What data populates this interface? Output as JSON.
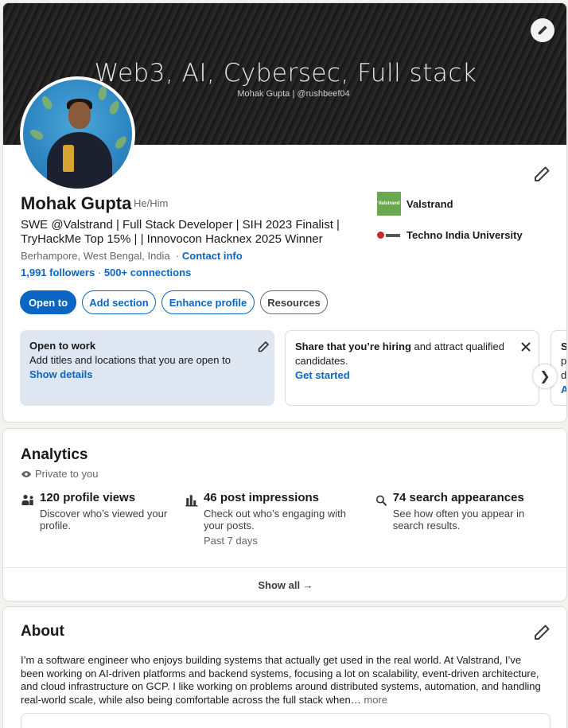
{
  "banner": {
    "title": "Web3, AI, Cybersec, Full stack",
    "subtitle": "Mohak Gupta | @rushbeef04"
  },
  "profile": {
    "name": "Mohak Gupta",
    "pronouns": "He/Him",
    "headline": "SWE @Valstrand | Full Stack Developer | SIH 2023 Finalist | TryHackMe Top 15% |  | Innovocon Hacknex 2025 Winner",
    "location": "Berhampore, West Bengal, India",
    "location_sep": "·",
    "contact_info": "Contact info",
    "followers": "1,991 followers",
    "network_sep": "·",
    "connections": "500+ connections"
  },
  "companies": [
    {
      "name": "Valstrand",
      "logo_text": "Valstrand"
    },
    {
      "name": "Techno India University"
    }
  ],
  "actions": {
    "open_to": "Open to",
    "add_section": "Add section",
    "enhance_profile": "Enhance profile",
    "resources": "Resources"
  },
  "open_to_work": {
    "title": "Open to work",
    "desc": "Add titles and locations that you are open to",
    "link": "Show details"
  },
  "hiring": {
    "bold": "Share that you’re hiring",
    "rest": " and attract qualified candidates.",
    "link": "Get started"
  },
  "peek_card": {
    "lines": [
      "Sh",
      "pr",
      "di",
      "A"
    ]
  },
  "carousel": {
    "next": "❯"
  },
  "analytics": {
    "title": "Analytics",
    "private": "Private to you",
    "metrics": [
      {
        "title": "120 profile views",
        "desc": "Discover who’s viewed your profile.",
        "icon": "people-icon"
      },
      {
        "title": "46 post impressions",
        "desc": "Check out who’s engaging with your posts.",
        "period": "Past 7 days",
        "icon": "bar-chart-icon"
      },
      {
        "title": "74 search appearances",
        "desc": "See how often you appear in search results.",
        "icon": "search-icon"
      }
    ],
    "show_all": "Show all →"
  },
  "about": {
    "title": "About",
    "text": "I’m a software engineer who enjoys building systems that actually get used in the real world. At Valstrand, I’ve been working on AI-driven platforms and backend systems, focusing a lot on scalability, event-driven architecture, and cloud infrastructure on GCP. I like working on problems around distributed systems, automation, and handling real-world scale, while also being comfortable across the full stack when…",
    "more": "more"
  },
  "colors": {
    "accent": "#0a66c2",
    "otw_bg": "#dde6f1",
    "page_bg": "#f4f2ee"
  }
}
